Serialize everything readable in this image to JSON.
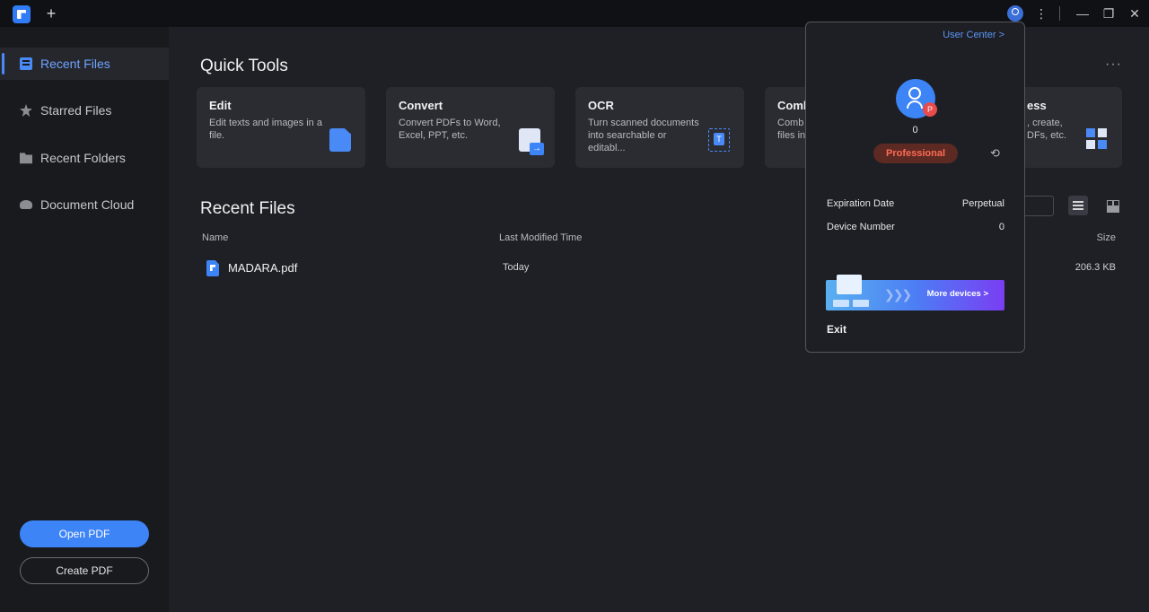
{
  "titlebar": {
    "new_tab_symbol": "+"
  },
  "sidebar": {
    "items": [
      {
        "label": "Recent Files",
        "icon": "document-icon",
        "active": true
      },
      {
        "label": "Starred Files",
        "icon": "star-icon",
        "active": false
      },
      {
        "label": "Recent Folders",
        "icon": "folder-icon",
        "active": false
      },
      {
        "label": "Document Cloud",
        "icon": "cloud-icon",
        "active": false
      }
    ],
    "open_pdf_label": "Open PDF",
    "create_pdf_label": "Create PDF"
  },
  "quick_tools": {
    "title": "Quick Tools",
    "more_symbol": "···",
    "tools": [
      {
        "title": "Edit",
        "desc": "Edit texts and images in a file."
      },
      {
        "title": "Convert",
        "desc": "Convert PDFs to Word, Excel, PPT, etc."
      },
      {
        "title": "OCR",
        "desc": "Turn scanned documents into searchable or editabl..."
      },
      {
        "title": "Comb",
        "desc": "Comb files in"
      },
      {
        "title": "ess",
        "desc": ", create, DFs, etc."
      }
    ]
  },
  "recent_files": {
    "title": "Recent Files",
    "columns": {
      "name": "Name",
      "modified": "Last Modified Time",
      "size": "Size"
    },
    "rows": [
      {
        "name": "MADARA.pdf",
        "modified": "Today",
        "size": "206.3 KB"
      }
    ]
  },
  "account_popup": {
    "user_center_label": "User Center >",
    "user_id": "0",
    "badge_letter": "P",
    "plan_label": "Professional",
    "expiration_label": "Expiration Date",
    "expiration_value": "Perpetual",
    "device_label": "Device Number",
    "device_value": "0",
    "banner_text": "More devices >",
    "exit_label": "Exit"
  },
  "colors": {
    "accent": "#3d84f7",
    "background": "#1f2025",
    "sidebar": "#191a1e",
    "card": "#2b2c32",
    "pro_text": "#ff6a55"
  }
}
